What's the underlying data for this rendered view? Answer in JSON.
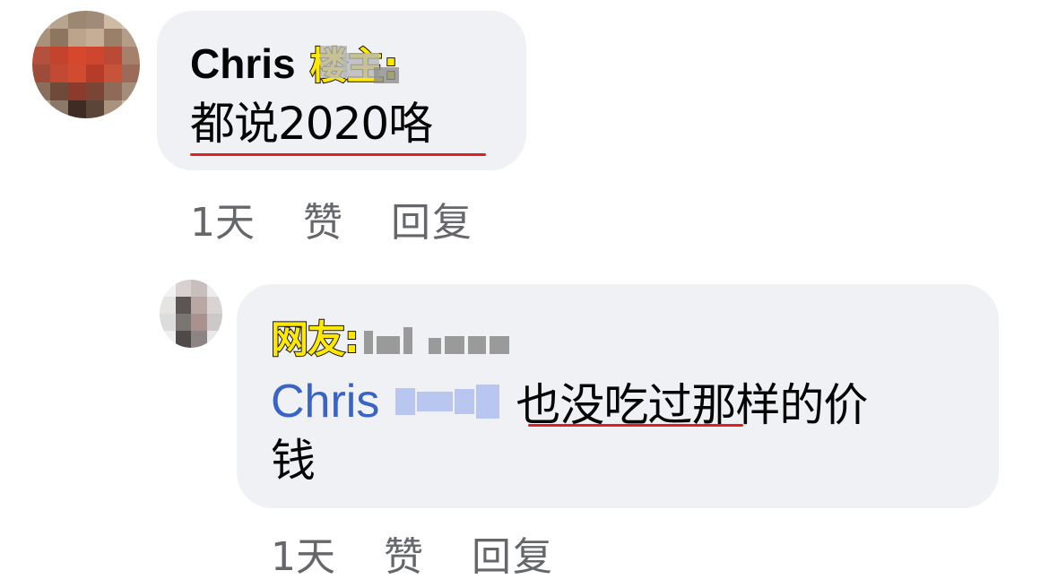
{
  "comment": {
    "author": "Chris",
    "tag": "楼主:",
    "text": "都说2020咯",
    "time": "1天",
    "like_label": "赞",
    "reply_label": "回复"
  },
  "reply": {
    "tag": "网友:",
    "mention": "Chris",
    "text": "也没吃过那样的价",
    "text_cont": "钱",
    "time": "1天",
    "like_label": "赞",
    "reply_label": "回复"
  },
  "colors": {
    "bubble": "#f0f1f4",
    "mention": "#3a63c8",
    "meta": "#65676b",
    "underline": "#e0201e",
    "tag_fill": "#ffe800"
  }
}
